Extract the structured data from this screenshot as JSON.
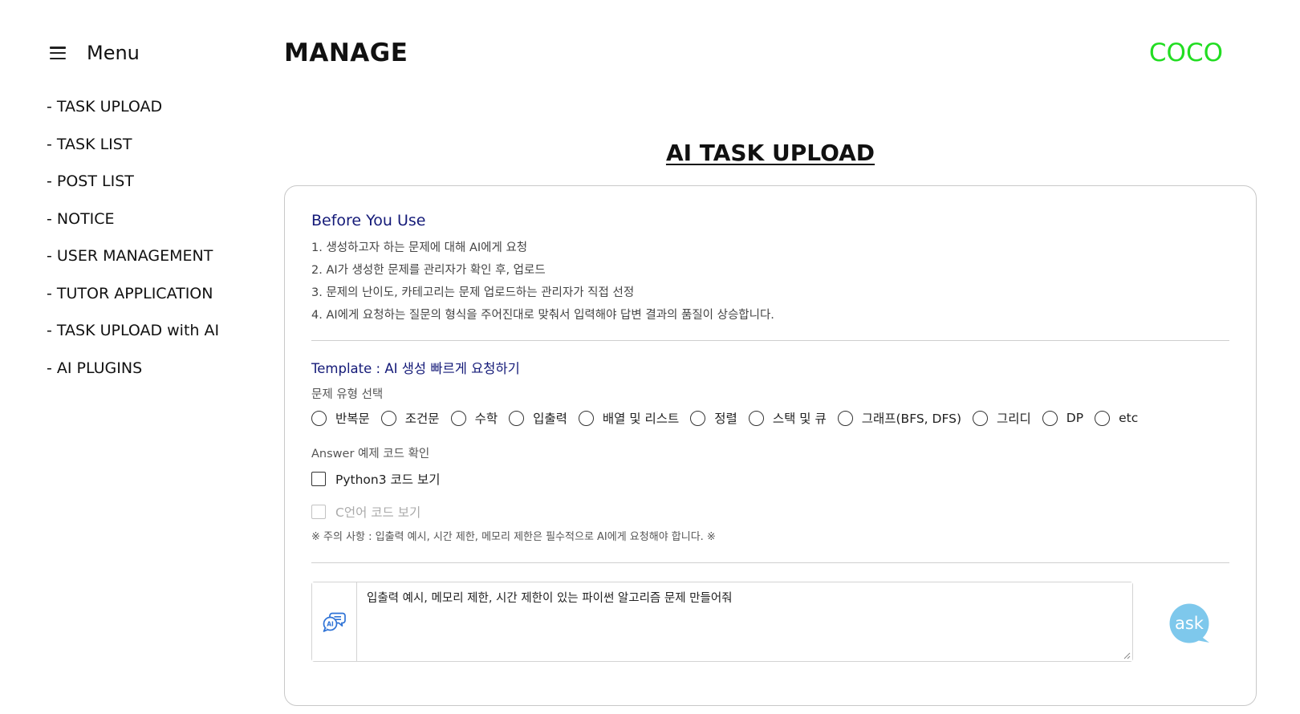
{
  "menu": {
    "title": "Menu",
    "icon": "hamburger-icon"
  },
  "sidebar": {
    "items": [
      {
        "label": "- TASK UPLOAD"
      },
      {
        "label": "- TASK LIST"
      },
      {
        "label": "- POST LIST"
      },
      {
        "label": "- NOTICE"
      },
      {
        "label": "- USER MANAGEMENT"
      },
      {
        "label": "- TUTOR APPLICATION"
      },
      {
        "label": "- TASK UPLOAD with AI"
      },
      {
        "label": "- AI PLUGINS"
      }
    ]
  },
  "header": {
    "title": "MANAGE",
    "brand": "COCO",
    "brand_color": "#22dd22"
  },
  "section": {
    "title": "AI TASK UPLOAD"
  },
  "guide": {
    "title": "Before You Use",
    "notes": [
      "1. 생성하고자 하는 문제에 대해 AI에게 요청",
      "2. AI가 생성한 문제를 관리자가 확인 후, 업로드",
      "3. 문제의 난이도, 카테고리는 문제 업로드하는 관리자가 직접 선정",
      "4. AI에게 요청하는 질문의 형식을 주어진대로 맞춰서 입력해야 답변 결과의 품질이 상승합니다."
    ]
  },
  "template": {
    "title": "Template : AI 생성 빠르게 요청하기",
    "type_label": "문제 유형 선택",
    "types": [
      "반복문",
      "조건문",
      "수학",
      "입출력",
      "배열 및 리스트",
      "정렬",
      "스택 및 큐",
      "그래프(BFS, DFS)",
      "그리디",
      "DP",
      "etc"
    ],
    "selected_type": null,
    "answer_label": "Answer 예제 코드 확인",
    "python_option": "Python3 코드 보기",
    "c_option": "C언어 코드 보기",
    "caution": "※ 주의 사항 : 입출력 예시, 시간 제한, 메모리 제한은 필수적으로 AI에게 요청해야 합니다. ※"
  },
  "prompt": {
    "value": "입출력 예시, 메모리 제한, 시간 제한이 있는 파이썬 알고리즘 문제 만들어줘",
    "icon": "ai-chat-icon"
  },
  "ask_button": {
    "label": "ask",
    "color": "#7ec8ec"
  }
}
